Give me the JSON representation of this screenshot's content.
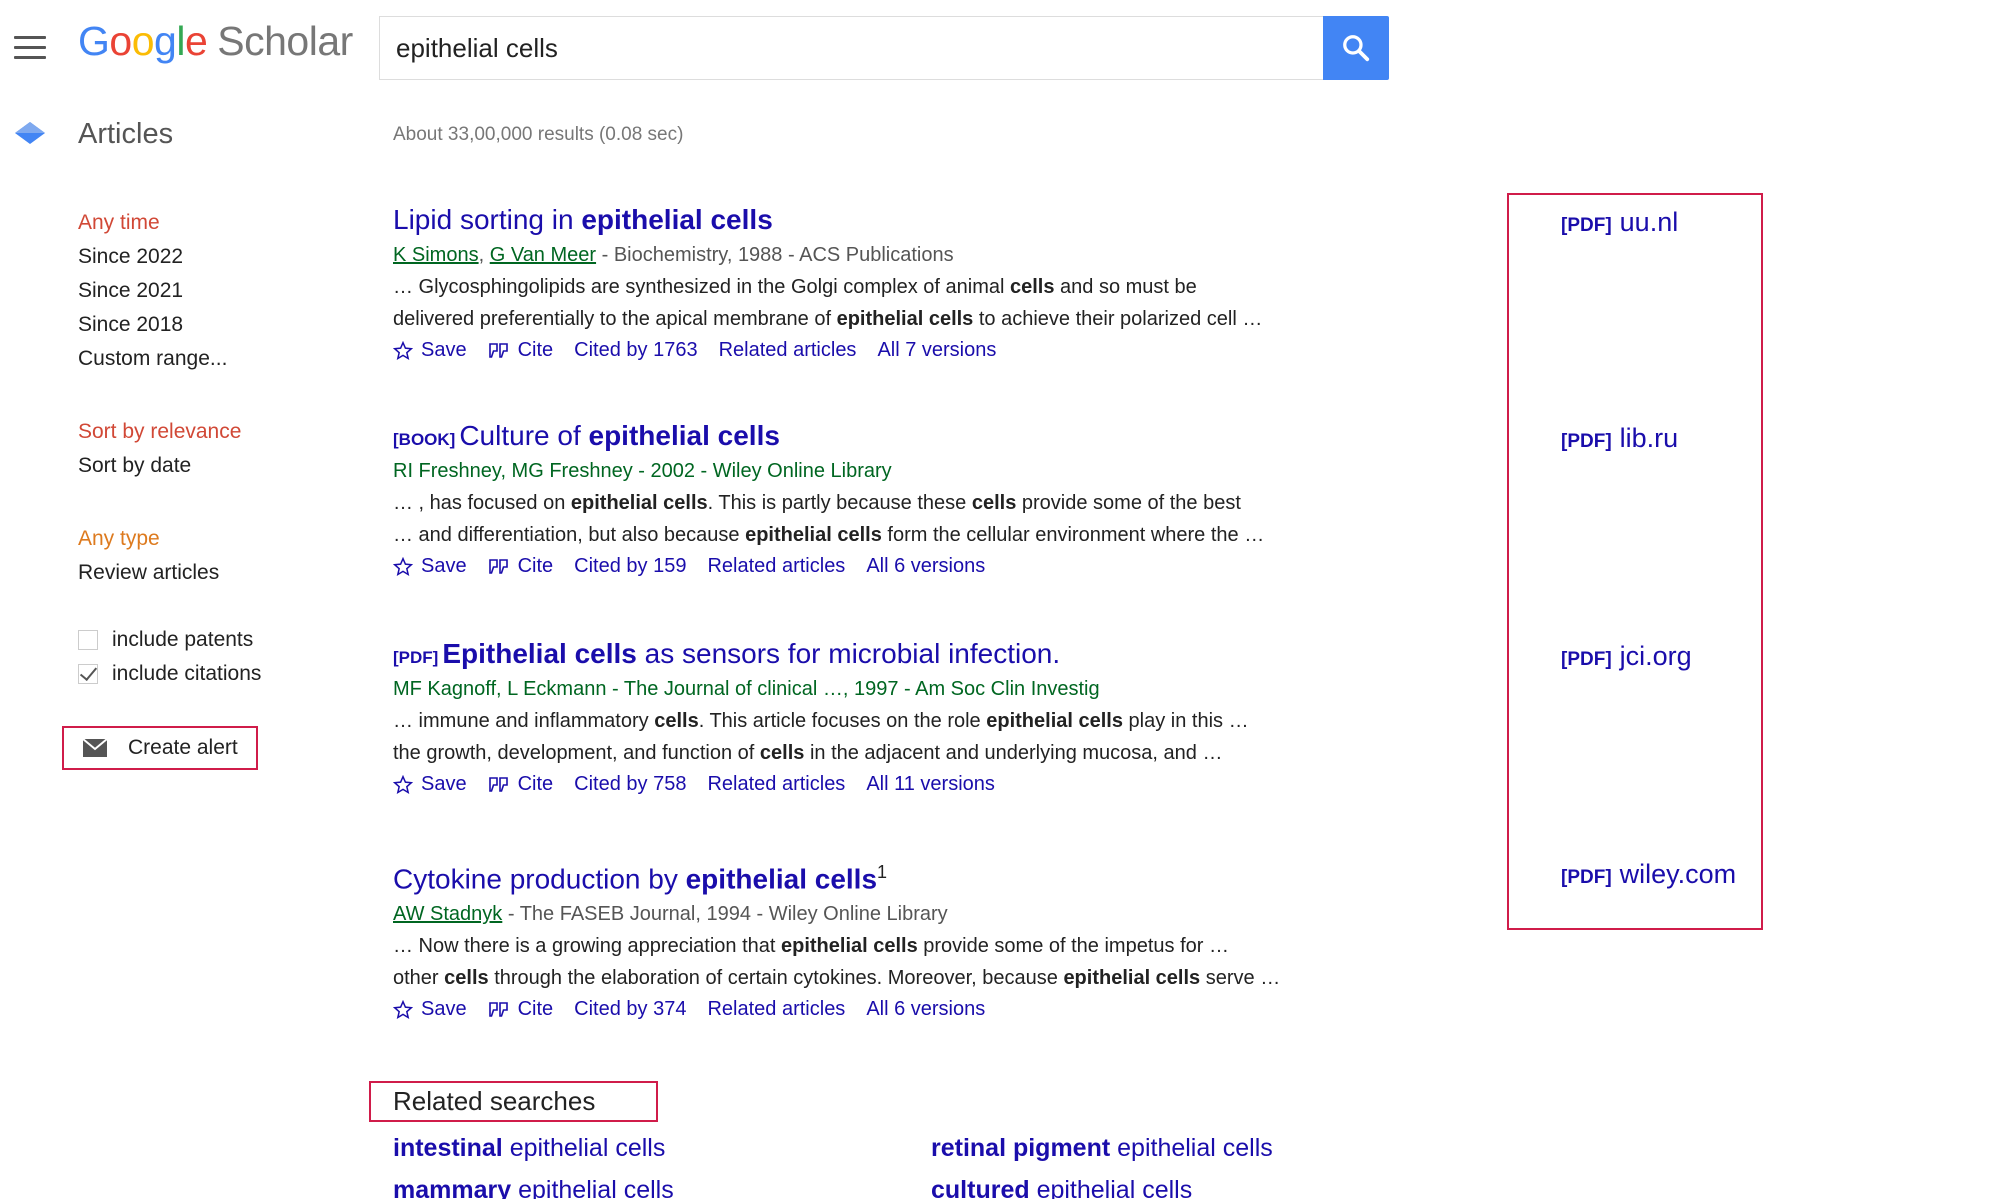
{
  "header": {
    "logo": {
      "g1": "G",
      "o1": "o",
      "o2": "o",
      "g2": "g",
      "l": "l",
      "e": "e",
      "product": "Scholar"
    },
    "search": {
      "value": "epithelial cells"
    }
  },
  "section": {
    "label": "Articles",
    "results_count": "About 33,00,000 results (0.08 sec)"
  },
  "sidebar": {
    "time": [
      "Any time",
      "Since 2022",
      "Since 2021",
      "Since 2018",
      "Custom range..."
    ],
    "sort": [
      "Sort by relevance",
      "Sort by date"
    ],
    "type": [
      "Any type",
      "Review articles"
    ],
    "include_patents": {
      "label": "include patents",
      "checked": false
    },
    "include_citations": {
      "label": "include citations",
      "checked": true
    },
    "create_alert": "Create alert"
  },
  "actions": {
    "save": "Save",
    "cite": "Cite"
  },
  "results": [
    {
      "type": "",
      "title_pre": "Lipid sorting in ",
      "title_bold": "epithelial cells",
      "title_post": "",
      "authors": [
        "K Simons",
        "G Van Meer"
      ],
      "meta_rest": " - Biochemistry, 1988 - ACS Publications",
      "snippet1": [
        "… Glycosphingolipids are synthesized in the Golgi complex of animal ",
        "cells",
        " and so must be"
      ],
      "snippet2": [
        "delivered preferentially to the apical membrane of ",
        "epithelial cells",
        " to achieve their polarized cell …"
      ],
      "cited": "Cited by 1763",
      "related": "Related articles",
      "versions": "All 7 versions"
    },
    {
      "type": "[BOOK]",
      "title_pre": "Culture of ",
      "title_bold": "epithelial cells",
      "title_post": "",
      "meta": "RI Freshney, MG Freshney - 2002 - Wiley Online Library",
      "snippet1": [
        "… , has focused on ",
        "epithelial cells",
        ". This is partly because these ",
        "cells",
        " provide some of the best"
      ],
      "snippet2": [
        "… and differentiation, but also because ",
        "epithelial cells",
        " form the cellular environment where the …"
      ],
      "cited": "Cited by 159",
      "related": "Related articles",
      "versions": "All 6 versions"
    },
    {
      "type": "[PDF]",
      "title_pre": "",
      "title_bold": "Epithelial cells",
      "title_post": " as sensors for microbial infection.",
      "meta": "MF Kagnoff, L Eckmann - The Journal of clinical …, 1997 - Am Soc Clin Investig",
      "snippet1": [
        "… immune and inflammatory ",
        "cells",
        ". This article focuses on the role ",
        "epithelial cells",
        " play in this …"
      ],
      "snippet2": [
        "the growth, development, and function of ",
        "cells",
        " in the adjacent and underlying mucosa, and …"
      ],
      "cited": "Cited by 758",
      "related": "Related articles",
      "versions": "All 11 versions"
    },
    {
      "type": "",
      "title_pre": "Cytokine production by ",
      "title_bold": "epithelial cells",
      "title_post": "",
      "superscript": "1",
      "authors": [
        "AW Stadnyk"
      ],
      "meta_rest": " - The FASEB Journal, 1994 - Wiley Online Library",
      "snippet1": [
        "… Now there is a growing appreciation that ",
        "epithelial cells",
        " provide some of the impetus for …"
      ],
      "snippet2": [
        "other ",
        "cells",
        " through the elaboration of certain cytokines. Moreover, because ",
        "epithelial cells",
        " serve …"
      ],
      "cited": "Cited by 374",
      "related": "Related articles",
      "versions": "All 6 versions"
    }
  ],
  "pdf_links": [
    {
      "tag": "[PDF]",
      "domain": "uu.nl"
    },
    {
      "tag": "[PDF]",
      "domain": "lib.ru"
    },
    {
      "tag": "[PDF]",
      "domain": "jci.org"
    },
    {
      "tag": "[PDF]",
      "domain": "wiley.com"
    }
  ],
  "related_searches": {
    "heading": "Related searches",
    "items": [
      {
        "bold": "intestinal",
        "rest": " epithelial cells"
      },
      {
        "bold": "retinal pigment",
        "rest": " epithelial cells"
      },
      {
        "bold": "mammary",
        "rest": " epithelial cells"
      },
      {
        "bold": "cultured",
        "rest": " epithelial cells"
      }
    ]
  },
  "colors": {
    "link": "#1a0dab",
    "meta_green": "#006621",
    "highlight_box": "#d01c4a",
    "search_button": "#4285f4",
    "active_filter": "#d14836"
  }
}
